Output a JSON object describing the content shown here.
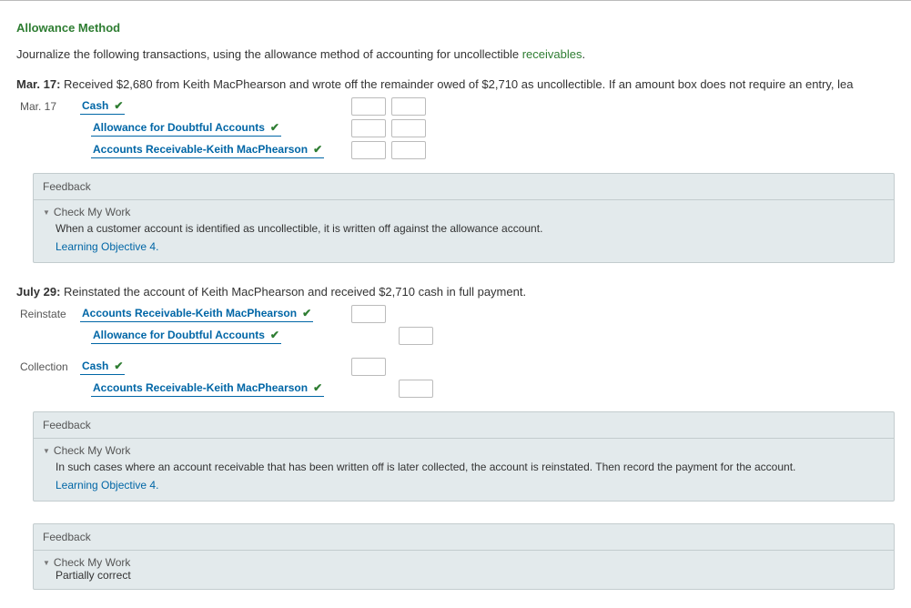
{
  "title": "Allowance Method",
  "instruction_start": "Journalize the following transactions, using the allowance method of accounting for uncollectible ",
  "instruction_link": "receivables",
  "instruction_end": ".",
  "txn1": {
    "date_label": "Mar. 17:",
    "desc": "  Received $2,680 from Keith MacPhearson and wrote off the remainder owed of $2,710 as uncollectible. If an amount box does not require an entry, lea",
    "row_date": "Mar. 17",
    "accounts": [
      {
        "name": "Cash",
        "indent": 0
      },
      {
        "name": "Allowance for Doubtful Accounts",
        "indent": 1
      },
      {
        "name": "Accounts Receivable-Keith MacPhearson",
        "indent": 1
      }
    ]
  },
  "feedback1": {
    "header": "Feedback",
    "toggle": "Check My Work",
    "body": "When a customer account is identified as uncollectible, it is written off against the allowance account.",
    "link": "Learning Objective 4",
    "link_suffix": "."
  },
  "txn2": {
    "date_label": "July 29:",
    "desc": "  Reinstated the account of Keith MacPhearson and received $2,710 cash in full payment.",
    "reinstate_label": "Reinstate",
    "reinstate_accounts": [
      {
        "name": "Accounts Receivable-Keith MacPhearson",
        "indent": 0,
        "debit": true
      },
      {
        "name": "Allowance for Doubtful Accounts",
        "indent": 1,
        "debit": false
      }
    ],
    "collection_label": "Collection",
    "collection_accounts": [
      {
        "name": "Cash",
        "indent": 0,
        "debit": true
      },
      {
        "name": "Accounts Receivable-Keith MacPhearson",
        "indent": 1,
        "debit": false
      }
    ]
  },
  "feedback2": {
    "header": "Feedback",
    "toggle": "Check My Work",
    "body": "In such cases where an account receivable that has been written off is later collected, the account is reinstated. Then record the payment for the account.",
    "link": "Learning Objective 4",
    "link_suffix": "."
  },
  "feedback3": {
    "header": "Feedback",
    "toggle": "Check My Work",
    "body": "Partially correct"
  }
}
